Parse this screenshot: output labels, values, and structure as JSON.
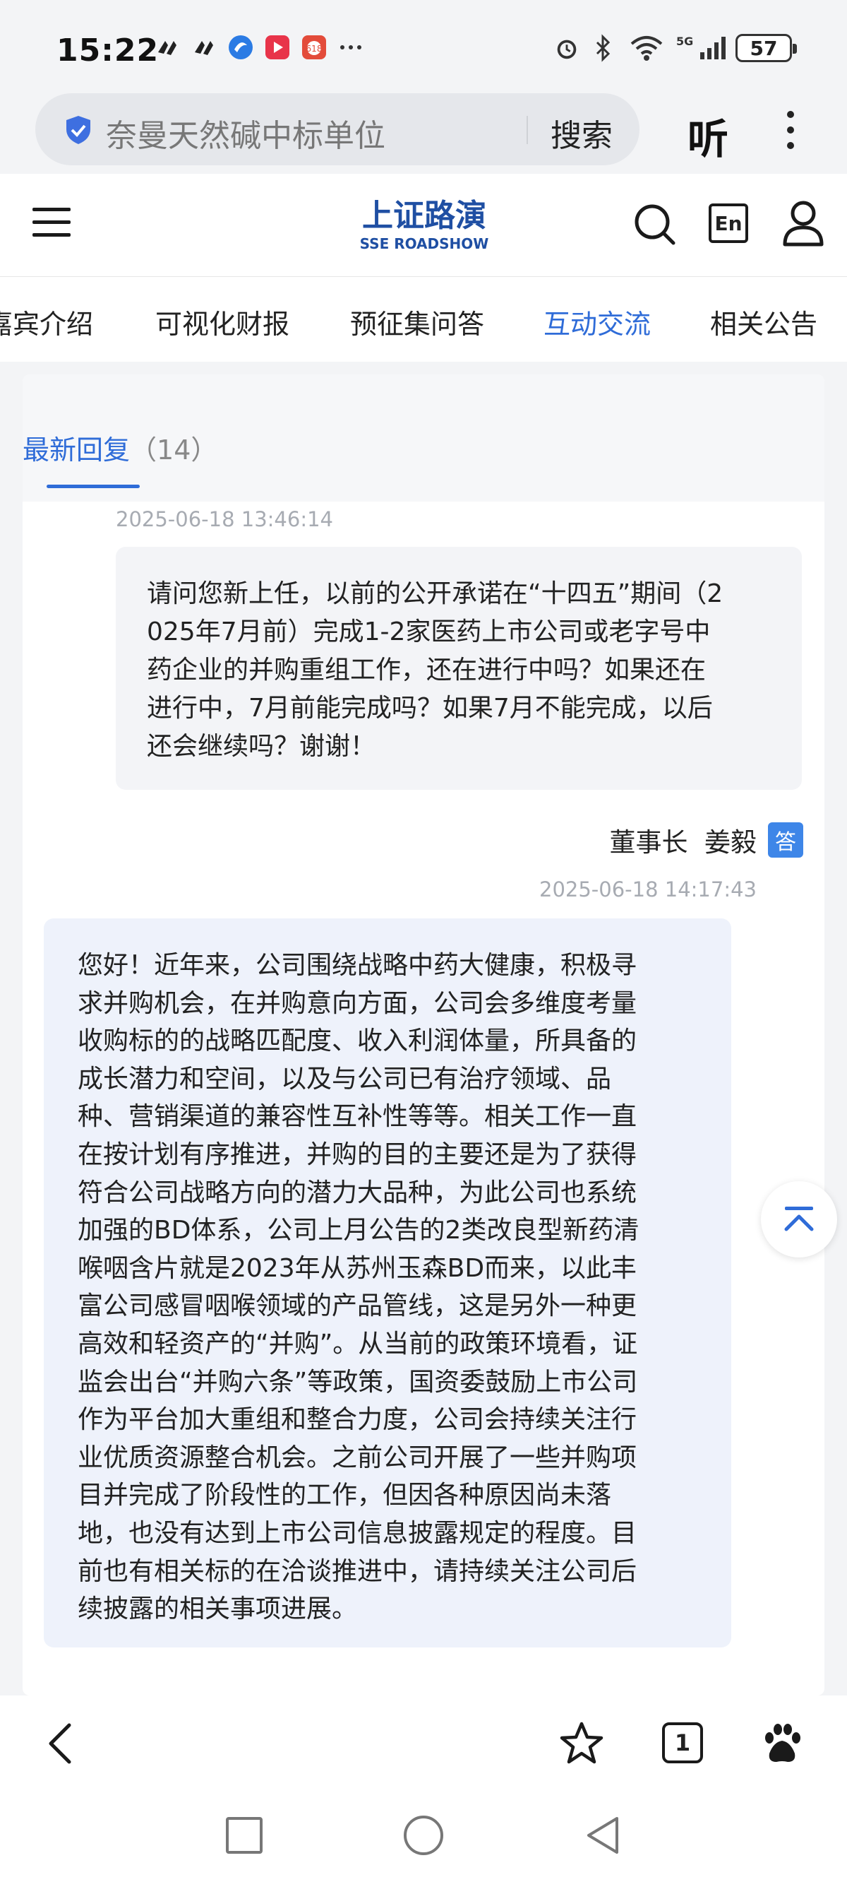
{
  "status_bar": {
    "time": "15:22",
    "battery": "57",
    "network": "5G"
  },
  "browser": {
    "search_text": "奈曼天然碱中标单位",
    "search_button": "搜索",
    "listen_button": "听"
  },
  "site": {
    "logo_text_top": "上证路演",
    "logo_text_bottom": "SSE ROADSHOW",
    "lang_button": "En"
  },
  "tabs": [
    {
      "label": "嘉宾介绍",
      "active": false
    },
    {
      "label": "可视化财报",
      "active": false
    },
    {
      "label": "预征集问答",
      "active": false
    },
    {
      "label": "互动交流",
      "active": true
    },
    {
      "label": "相关公告",
      "active": false
    }
  ],
  "section": {
    "title": "最新回复",
    "count": "（14）"
  },
  "question": {
    "time": "2025-06-18 13:46:14",
    "lines": [
      "请问您新上任，以前的公开承诺在“十四五”期间（2",
      "025年7月前）完成1-2家医药上市公司或老字号中",
      "药企业的并购重组工作，还在进行中吗？如果还在",
      "进行中，7月前能完成吗？如果7月不能完成，以后",
      "还会继续吗？谢谢！"
    ]
  },
  "answer": {
    "answerer": "董事长  姜毅",
    "badge": "答",
    "time": "2025-06-18 14:17:43",
    "lines": [
      "您好！近年来，公司围绕战略中药大健康，积极寻",
      "求并购机会，在并购意向方面，公司会多维度考量",
      "收购标的的战略匹配度、收入利润体量，所具备的",
      "成长潜力和空间，以及与公司已有治疗领域、品",
      "种、营销渠道的兼容性互补性等等。相关工作一直",
      "在按计划有序推进，并购的目的主要还是为了获得",
      "符合公司战略方向的潜力大品种，为此公司也系统",
      "加强的BD体系，公司上月公告的2类改良型新药清",
      "喉咽含片就是2023年从苏州玉森BD而来，以此丰",
      "富公司感冒咽喉领域的产品管线，这是另外一种更",
      "高效和轻资产的“并购”。从当前的政策环境看，证",
      "监会出台“并购六条”等政策，国资委鼓励上市公司",
      "作为平台加大重组和整合力度，公司会持续关注行",
      "业优质资源整合机会。之前公司开展了一些并购项",
      "目并完成了阶段性的工作，但因各种原因尚未落",
      "地，也没有达到上市公司信息披露规定的程度。目",
      "前也有相关标的在洽谈推进中，请持续关注公司后",
      "续披露的相关事项进展。"
    ]
  },
  "bottom_bar": {
    "tabs_count": "1"
  },
  "colors": {
    "accent": "#2f6cd8",
    "badge": "#3e86e8",
    "question_bg": "#f3f4f7",
    "answer_bg": "#eef2fb",
    "logo_blue": "#1f4fa3"
  }
}
